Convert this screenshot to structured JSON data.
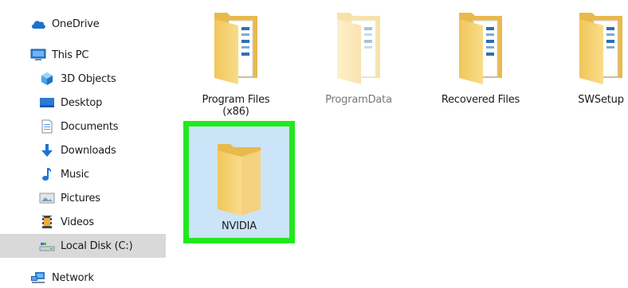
{
  "sidebar": {
    "items": [
      {
        "label": "OneDrive",
        "icon": "cloud-icon"
      },
      {
        "label": "This PC",
        "icon": "computer-icon"
      },
      {
        "label": "3D Objects",
        "icon": "cube-icon"
      },
      {
        "label": "Desktop",
        "icon": "desktop-icon"
      },
      {
        "label": "Documents",
        "icon": "document-icon"
      },
      {
        "label": "Downloads",
        "icon": "download-arrow-icon"
      },
      {
        "label": "Music",
        "icon": "music-note-icon"
      },
      {
        "label": "Pictures",
        "icon": "pictures-icon"
      },
      {
        "label": "Videos",
        "icon": "film-icon"
      },
      {
        "label": "Local Disk (C:)",
        "icon": "drive-icon",
        "selected": true
      },
      {
        "label": "Network",
        "icon": "network-icon"
      }
    ]
  },
  "main": {
    "folders": [
      {
        "label": "Program Files (x86)",
        "line1": "Program Files",
        "line2": "(x86)"
      },
      {
        "label": "ProgramData",
        "line1": "ProgramData",
        "faded": true
      },
      {
        "label": "Recovered Files",
        "line1": "Recovered Files"
      },
      {
        "label": "SWSetup",
        "line1": "SWSetup"
      },
      {
        "label": "NVIDIA",
        "line1": "NVIDIA",
        "selected": true
      }
    ]
  },
  "colors": {
    "selection_background": "#cce4f7",
    "highlight_border": "#22e81f",
    "sidebar_selected": "#d9d9d9",
    "folder_yellow": "#f8d775"
  }
}
